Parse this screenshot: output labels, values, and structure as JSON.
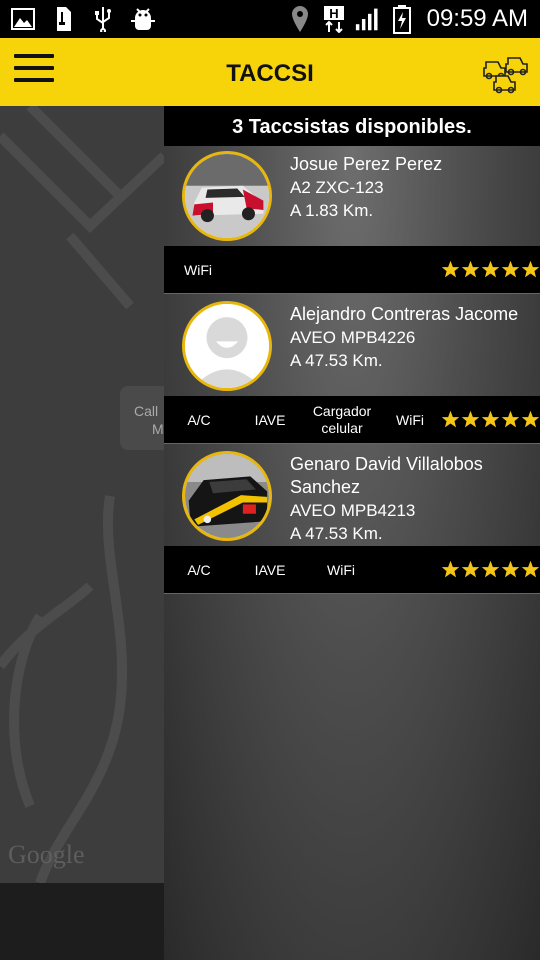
{
  "status_bar": {
    "left_icons": [
      "gallery-icon",
      "sd-card-icon",
      "usb-icon",
      "android-debug-icon"
    ],
    "right_icons": [
      "location-pin-icon",
      "data-h-icon",
      "signal-icon",
      "battery-charging-icon"
    ],
    "time": "09:59 AM"
  },
  "app_bar": {
    "title": "TACCSI",
    "menu_icon": "hamburger-menu-icon",
    "action_icon": "taxi-fleet-icon",
    "background": "#f7d40a"
  },
  "map": {
    "callout_text_1": "Call",
    "callout_text_2": "M",
    "watermark": "Google"
  },
  "panel": {
    "header": "3 Taccsistas disponibles.",
    "drivers": [
      {
        "name": "Josue Perez Perez",
        "car": "A2 ZXC-123",
        "distance": "A 1.83 Km.",
        "photo": "taxi-car-photo",
        "features": [
          "WiFi"
        ],
        "rating": 5
      },
      {
        "name": "Alejandro Contreras Jacome",
        "car": "AVEO MPB4226",
        "distance": "A 47.53 Km.",
        "photo": "default-user-avatar",
        "features": [
          "A/C",
          "IAVE",
          "Cargador celular",
          "WiFi"
        ],
        "rating": 5
      },
      {
        "name": "Genaro David Villalobos Sanchez",
        "car": "AVEO MPB4213",
        "distance": "A 47.53 Km.",
        "photo": "black-taxi-photo",
        "features": [
          "A/C",
          "IAVE",
          "WiFi"
        ],
        "rating": 5
      }
    ]
  },
  "colors": {
    "accent": "#f7d40a",
    "avatar_border": "#e8b70d",
    "star": "#f5c518"
  }
}
